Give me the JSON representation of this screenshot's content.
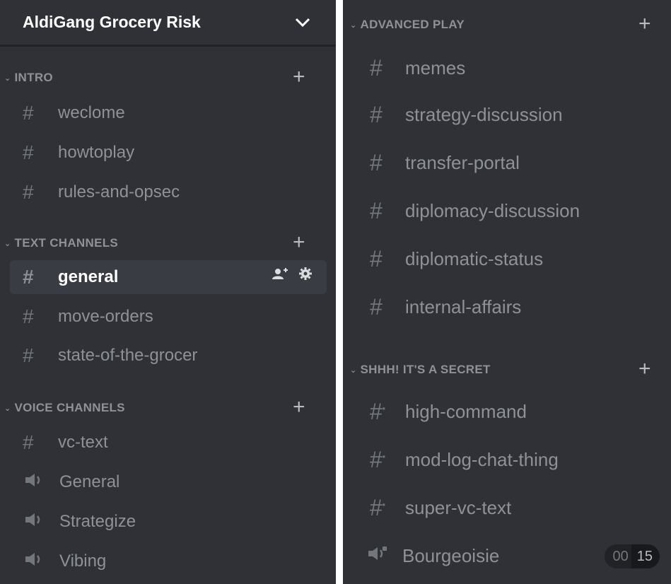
{
  "server": {
    "name": "AldiGang Grocery Risk",
    "chevron_icon": "chevron-down-icon"
  },
  "left": {
    "categories": {
      "intro": {
        "label": "INTRO",
        "channels": [
          "weclome",
          "howtoplay",
          "rules-and-opsec"
        ]
      },
      "text": {
        "label": "TEXT CHANNELS",
        "channels": [
          "general",
          "move-orders",
          "state-of-the-grocer"
        ]
      },
      "voice": {
        "label": "VOICE CHANNELS",
        "text_channel": "vc-text",
        "voice_channels": [
          "General",
          "Strategize",
          "Vibing"
        ]
      }
    },
    "selected_channel": "general"
  },
  "right": {
    "advanced": {
      "label": "ADVANCED PLAY",
      "channels": [
        "memes",
        "strategy-discussion",
        "transfer-portal",
        "diplomacy-discussion",
        "diplomatic-status",
        "internal-affairs"
      ]
    },
    "secret": {
      "label": "SHHH! IT'S A SECRET",
      "channels": [
        "high-command",
        "mod-log-chat-thing",
        "super-vc-text"
      ],
      "voice_channel": "Bourgeoisie",
      "user_count": "00",
      "user_limit": "15"
    }
  },
  "colors": {
    "panel_bg": "#2f3136",
    "selected_bg": "#393c43",
    "muted_text": "#8e9297"
  }
}
